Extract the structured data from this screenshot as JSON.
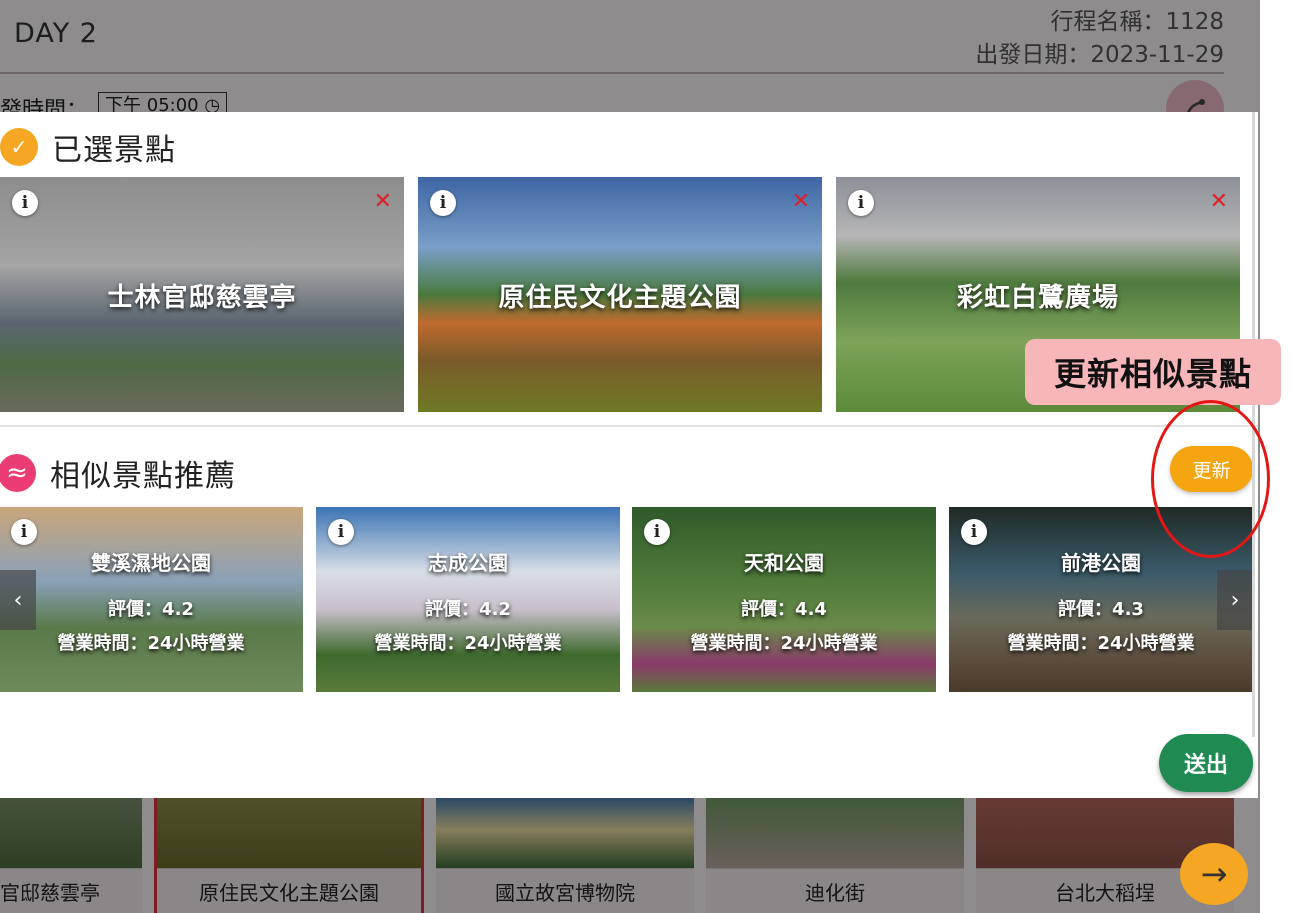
{
  "background": {
    "day_label": "DAY 2",
    "trip_name": "行程名稱：1128",
    "departure_date": "出發日期：2023-11-29",
    "departure_time_label": "發時間：",
    "departure_time_value": "下午 05:00",
    "clock_icon": "clock-icon",
    "route_icon": "route-icon",
    "next_icon": "arrow-right-icon",
    "itinerary": [
      "官邸慈雲亭",
      "原住民文化主題公園",
      "國立故宮博物院",
      "迪化街",
      "台北大稻埕"
    ]
  },
  "modal": {
    "selected_section_title": "已選景點",
    "selected_section_icon": "check-icon",
    "selected": [
      {
        "name": "士林官邸慈雲亭"
      },
      {
        "name": "原住民文化主題公園"
      },
      {
        "name": "彩虹白鷺廣場"
      }
    ],
    "info_glyph": "i",
    "remove_glyph": "✕",
    "similar_section_title": "相似景點推薦",
    "similar_section_icon": "similar-icon",
    "refresh_label": "更新",
    "recommendations": [
      {
        "name": "雙溪濕地公園",
        "rating": "評價：4.2",
        "hours": "營業時間：24小時營業"
      },
      {
        "name": "志成公園",
        "rating": "評價：4.2",
        "hours": "營業時間：24小時營業"
      },
      {
        "name": "天和公園",
        "rating": "評價：4.4",
        "hours": "營業時間：24小時營業"
      },
      {
        "name": "前港公園",
        "rating": "評價：4.3",
        "hours": "營業時間：24小時營業"
      }
    ],
    "prev_glyph": "‹",
    "next_glyph": "›",
    "submit_label": "送出"
  },
  "annotation": {
    "callout_text": "更新相似景點"
  },
  "colors": {
    "accent_orange": "#f5a623",
    "similar_pink": "#ec3d72",
    "submit_green": "#1f8a52",
    "remove_red": "#e01e26",
    "annotation_red": "#e51616",
    "callout_bg": "#f7b6b8"
  }
}
